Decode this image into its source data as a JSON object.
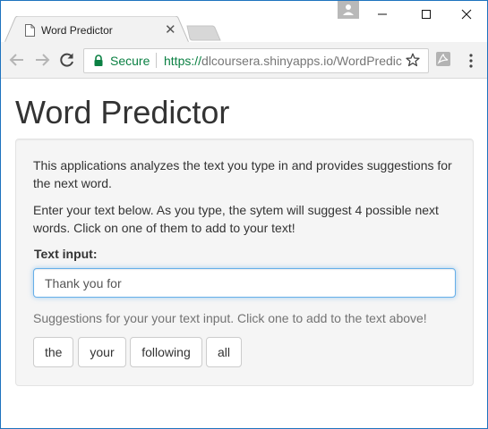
{
  "browser": {
    "tab": {
      "title": "Word Predictor",
      "close_glyph": "✕"
    },
    "address_bar": {
      "security_label": "Secure",
      "url_protocol": "https://",
      "url_rest": "dlcoursera.shinyapps.io/WordPredic"
    },
    "icons": {
      "tab_page": "page-icon",
      "back": "back-arrow-icon",
      "forward": "forward-arrow-icon",
      "reload": "reload-icon",
      "lock": "lock-icon",
      "bookmark": "star-icon",
      "extension": "pdf-extension-icon",
      "menu": "kebab-menu-icon",
      "profile": "profile-icon",
      "minimize": "minimize-icon",
      "maximize": "maximize-icon",
      "close": "close-icon"
    },
    "colors": {
      "secure_green": "#0b8043",
      "window_border": "#1e73be",
      "focus_blue": "#66afe9"
    }
  },
  "page": {
    "title": "Word Predictor",
    "intro_text": "This applications analyzes the text you type in and provides suggestions for the next word.",
    "instructions_text": "Enter your text below. As you type, the sytem will suggest 4 possible next words. Click on one of them to add to your text!",
    "input_label": "Text input:",
    "input_value": "Thank you for",
    "suggestions_help": "Suggestions for your your text input. Click one to add to the text above!",
    "suggestions": [
      "the",
      "your",
      "following",
      "all"
    ]
  }
}
